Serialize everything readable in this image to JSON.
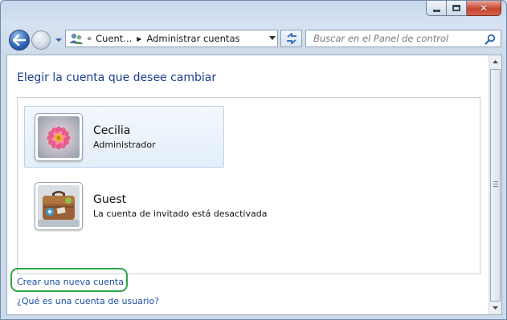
{
  "window": {
    "caption": {
      "minimize": "–",
      "maximize": "□",
      "close": "✕"
    }
  },
  "nav": {
    "back_icon": "back-arrow-icon",
    "forward_icon": "forward-arrow-icon"
  },
  "address": {
    "overflow": "«",
    "crumbs": [
      "Cuent...",
      "Administrar cuentas"
    ],
    "separator": "▶"
  },
  "search": {
    "placeholder": "Buscar en el Panel de control"
  },
  "main": {
    "heading": "Elegir la cuenta que desee cambiar",
    "accounts": [
      {
        "name": "Cecilia",
        "role": "Administrador",
        "icon": "flower-avatar-icon",
        "selected": true
      },
      {
        "name": "Guest",
        "role": "La cuenta de invitado está desactivada",
        "icon": "briefcase-avatar-icon",
        "selected": false
      }
    ],
    "links": {
      "create": "Crear una nueva cuenta",
      "what": "¿Qué es una cuenta de usuario?"
    }
  },
  "colors": {
    "heading": "#1b3d8f",
    "link": "#1c4fa0",
    "highlight_ring": "#2aa84a",
    "close_button": "#c8452e"
  }
}
